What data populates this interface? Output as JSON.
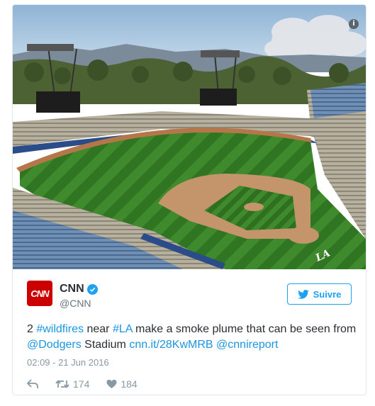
{
  "photo": {
    "alt_icon": "i"
  },
  "tweet": {
    "avatar_text": "CNN",
    "display_name": "CNN",
    "handle": "@CNN",
    "follow_label": "Suivre",
    "text_parts": {
      "p1": "2 ",
      "l1": "#wildfires",
      "p2": " near ",
      "l2": "#LA",
      "p3": " make a smoke plume that can be seen from ",
      "l3": "@Dodgers",
      "p4": " Stadium ",
      "l4": "cnn.it/28KwMRB",
      "p5": " ",
      "l5": "@cnnireport"
    },
    "timestamp": "02:09 - 21 Jun 2016",
    "retweets": "174",
    "likes": "184"
  },
  "colors": {
    "brand": "#cc0000",
    "link": "#1b95e0",
    "accent": "#1da1f2",
    "muted": "#8899a6"
  },
  "icons": [
    "info-icon",
    "verified-icon",
    "twitter-bird-icon",
    "reply-icon",
    "retweet-icon",
    "heart-icon"
  ]
}
